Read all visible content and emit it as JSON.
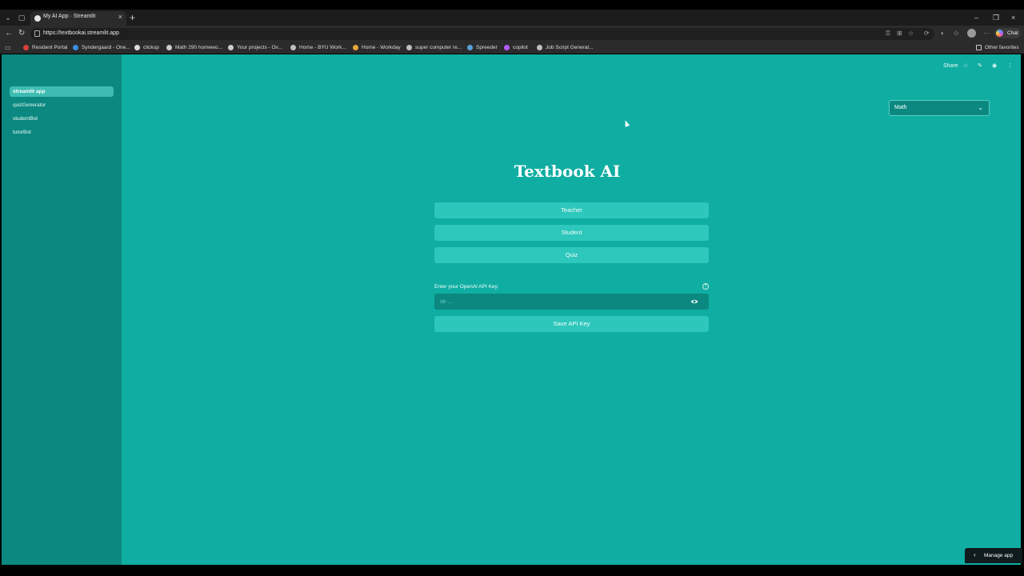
{
  "browser": {
    "tab_title": "My AI App · Streamlit",
    "url": "https://textbookai.streamlit.app",
    "new_tab_glyph": "+",
    "copilot_label": "Chat",
    "bookmarks": [
      {
        "label": "Resident Portal",
        "icon": "portal-icon",
        "color": "#d9403a"
      },
      {
        "label": "Syndergaard - One...",
        "icon": "cloud-icon",
        "color": "#3b8de0"
      },
      {
        "label": "clickup",
        "icon": "clickup-icon",
        "color": "#dddddd"
      },
      {
        "label": "Math 290 homewo...",
        "icon": "globe-icon",
        "color": "#cccccc"
      },
      {
        "label": "Your projects - Ov...",
        "icon": "globe-icon",
        "color": "#cccccc"
      },
      {
        "label": "Home - BYU Work...",
        "icon": "y-icon",
        "color": "#bfbfbf"
      },
      {
        "label": "Home - Workday",
        "icon": "workday-icon",
        "color": "#e3a73a"
      },
      {
        "label": "super computer re...",
        "icon": "y-icon",
        "color": "#bfbfbf"
      },
      {
        "label": "Spreeder",
        "icon": "spreeder-icon",
        "color": "#5aa0d8"
      },
      {
        "label": "copilot",
        "icon": "copilot-icon",
        "color": "#b35cff"
      },
      {
        "label": "Job Script Generat...",
        "icon": "y-icon",
        "color": "#bfbfbf"
      }
    ],
    "other_favorites": "Other favorites"
  },
  "sidebar": {
    "items": [
      {
        "label": "streamlit app",
        "active": true
      },
      {
        "label": "quizGenerator",
        "active": false
      },
      {
        "label": "studentBot",
        "active": false
      },
      {
        "label": "tutorBot",
        "active": false
      }
    ]
  },
  "toolbar": {
    "share_label": "Share"
  },
  "subject_select": {
    "value": "Math"
  },
  "main": {
    "title": "Textbook AI",
    "buttons": {
      "teacher": "Teacher",
      "student": "Student",
      "quiz": "Quiz"
    },
    "api_key": {
      "label": "Enter your OpenAI API Key:",
      "placeholder": "sk-...",
      "value": ""
    },
    "save_label": "Save API Key"
  },
  "manage_app": {
    "label": "Manage app"
  },
  "colors": {
    "app_bg": "#0fada2",
    "sidebar_bg": "#0b887f",
    "button_bg": "#2ec7bb"
  }
}
